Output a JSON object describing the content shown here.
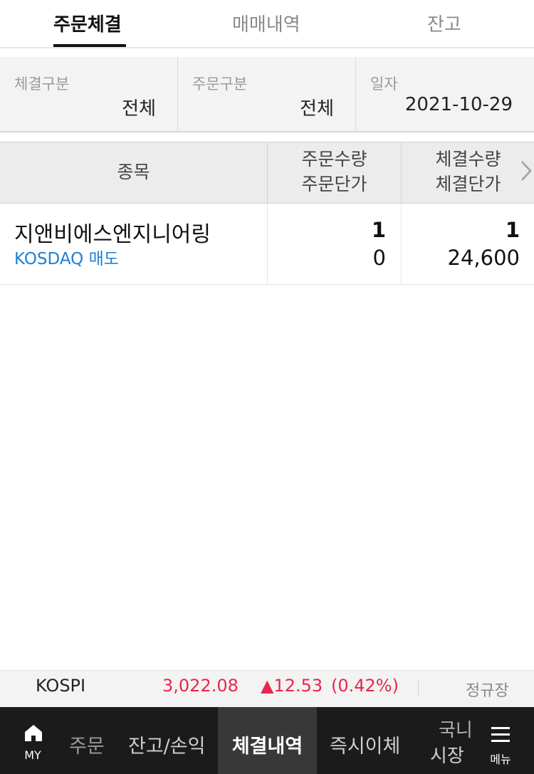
{
  "tabs": [
    {
      "label": "주문체결",
      "active": true
    },
    {
      "label": "매매내역",
      "active": false
    },
    {
      "label": "잔고",
      "active": false
    }
  ],
  "filters": [
    {
      "label": "체결구분",
      "value": "전체"
    },
    {
      "label": "주문구분",
      "value": "전체"
    },
    {
      "label": "일자",
      "value": "2021-10-29"
    }
  ],
  "table": {
    "headers": {
      "stock": "종목",
      "order_qty": "주문수량",
      "order_price": "주문단가",
      "filled_qty": "체결수량",
      "filled_price": "체결단가"
    },
    "next_icon": "chevron-right-icon",
    "rows": [
      {
        "name": "지앤비에스엔지니어링",
        "market_side": "KOSDAQ 매도",
        "order_qty": "1",
        "order_price": "0",
        "filled_qty": "1",
        "filled_price": "24,600"
      }
    ]
  },
  "ticker": {
    "index": "KOSPI",
    "value": "3,022.08",
    "change": "▲12.53",
    "change_pct": "(0.42%)",
    "session": "정규장",
    "up_color": "#e8264f"
  },
  "bottom_nav": {
    "home_label": "MY",
    "home_icon": "home-icon",
    "items": [
      {
        "label": "주문",
        "active": false
      },
      {
        "label": "잔고/손익",
        "active": false
      },
      {
        "label": "체결내역",
        "active": true
      },
      {
        "label": "즉시이체",
        "active": false
      }
    ],
    "truncated_item": {
      "line1": "국니",
      "line2": "시장"
    },
    "menu_label": "메뉴",
    "menu_icon": "hamburger-menu-icon"
  }
}
